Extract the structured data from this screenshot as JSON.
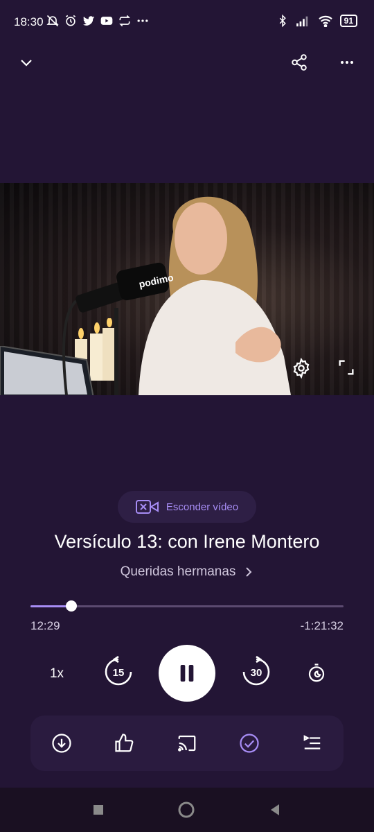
{
  "status_bar": {
    "time": "18:30",
    "battery": "91"
  },
  "video": {
    "brand_on_mic": "podimo"
  },
  "toggle_video": {
    "label": "Esconder vídeo"
  },
  "episode": {
    "title": "Versículo 13: con Irene Montero",
    "show": "Queridas hermanas"
  },
  "playback": {
    "elapsed": "12:29",
    "remaining": "-1:21:32",
    "progress_fraction": 0.13,
    "speed": "1x",
    "skip_back_seconds": "15",
    "skip_forward_seconds": "30"
  },
  "colors": {
    "background": "#231535",
    "accent": "#a78df5",
    "action_bar": "#2a1b3f"
  }
}
